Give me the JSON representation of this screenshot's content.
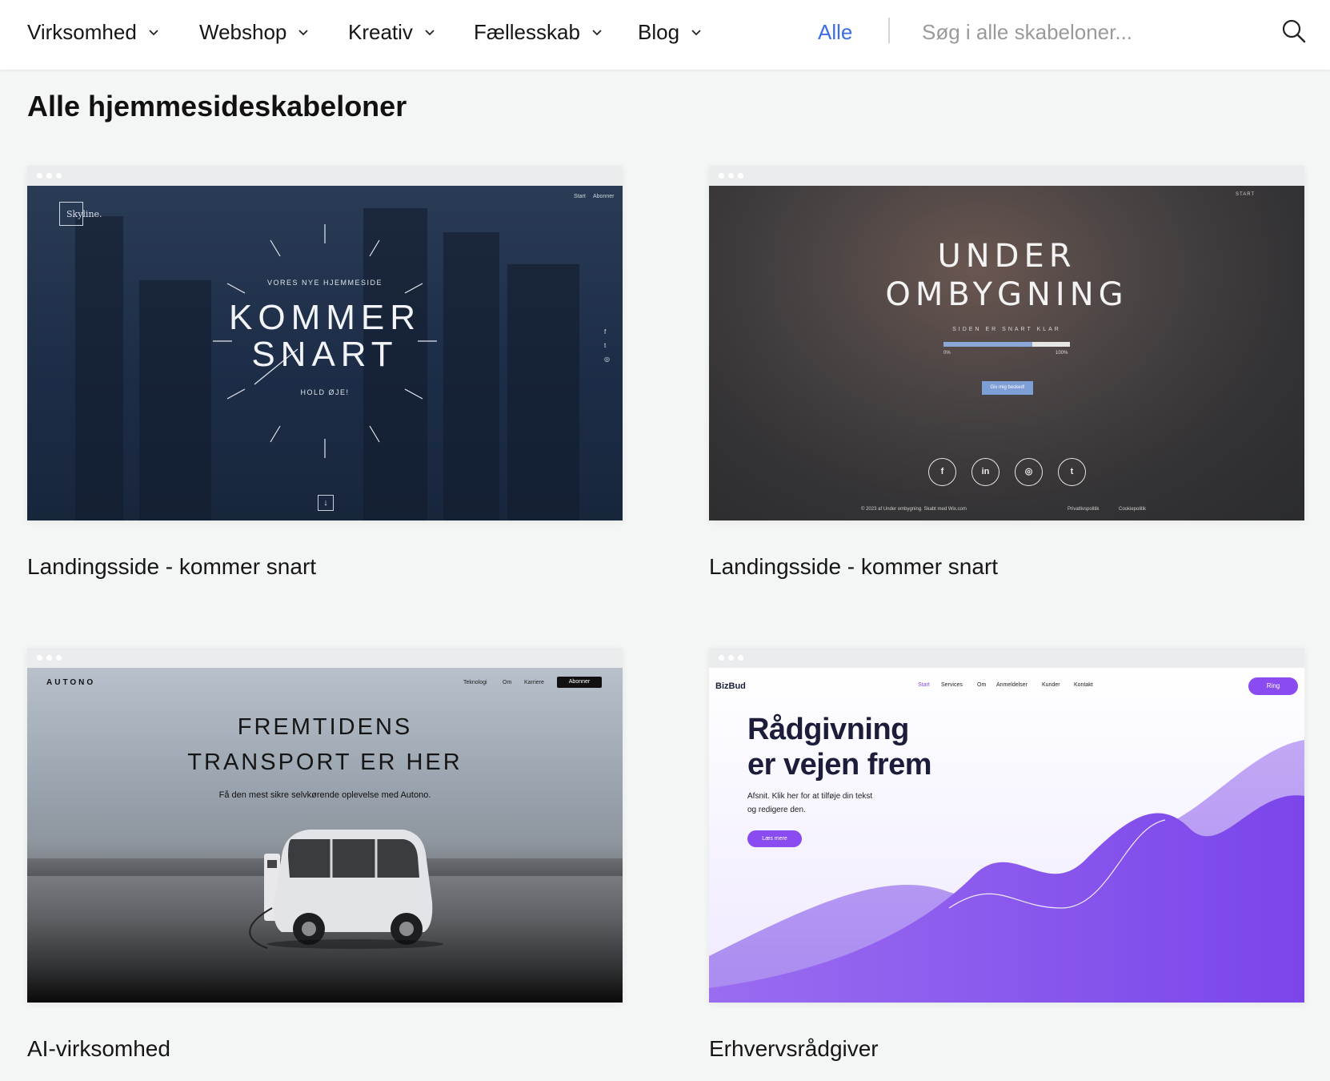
{
  "nav": {
    "categories": [
      "Virksomhed",
      "Webshop",
      "Kreativ",
      "Fællesskab",
      "Blog"
    ],
    "all": "Alle",
    "search_placeholder": "Søg i alle skabeloner..."
  },
  "page": {
    "title": "Alle hjemmesideskabeloner"
  },
  "cards": [
    {
      "title": "Landingsside - kommer snart",
      "preview": {
        "logo": "Skyline.",
        "nav": [
          "Start",
          "Abonner"
        ],
        "kicker": "VORES NYE HJEMMESIDE",
        "line1": "KOMMER",
        "line2": "SNART",
        "tagline": "HOLD ØJE!",
        "social": [
          "f",
          "t",
          "◎"
        ],
        "arrow": "↓"
      }
    },
    {
      "title": "Landingsside - kommer snart",
      "preview": {
        "nav": "START",
        "line1": "UNDER",
        "line2": "OMBYGNING",
        "sub": "SIDEN ER SNART KLAR",
        "progress": 0.7,
        "pct_start": "0%",
        "pct_end": "100%",
        "button": "Giv mig besked!",
        "social": [
          "f",
          "in",
          "◎",
          "t"
        ],
        "footer_left": "© 2023 af Under ombygning. Skabt med Wix.com",
        "footer_links": [
          "Privatlivspolitik",
          "Cookiepolitik"
        ]
      }
    },
    {
      "title": "AI-virksomhed",
      "preview": {
        "brand": "AUTONO",
        "nav": [
          "Teknologi",
          "Om",
          "Karriere"
        ],
        "cta": "Abonner",
        "line1": "FREMTIDENS",
        "line2": "TRANSPORT ER HER",
        "sub": "Få den mest sikre selvkørende oplevelse med Autono."
      }
    },
    {
      "title": "Erhvervsrådgiver",
      "preview": {
        "brand": "BizBud",
        "nav": [
          "Start",
          "Services",
          "Om",
          "Anmeldelser",
          "Kunder",
          "Kontakt"
        ],
        "cta": "Ring",
        "line1": "Rådgivning",
        "line2": "er vejen frem",
        "sub1": "Afsnit. Klik her for at tilføje din tekst",
        "sub2": "og redigere den.",
        "button": "Læs mere"
      }
    }
  ],
  "colors": {
    "accent": "#3b6ee6",
    "purple": "#8a4cf0"
  }
}
